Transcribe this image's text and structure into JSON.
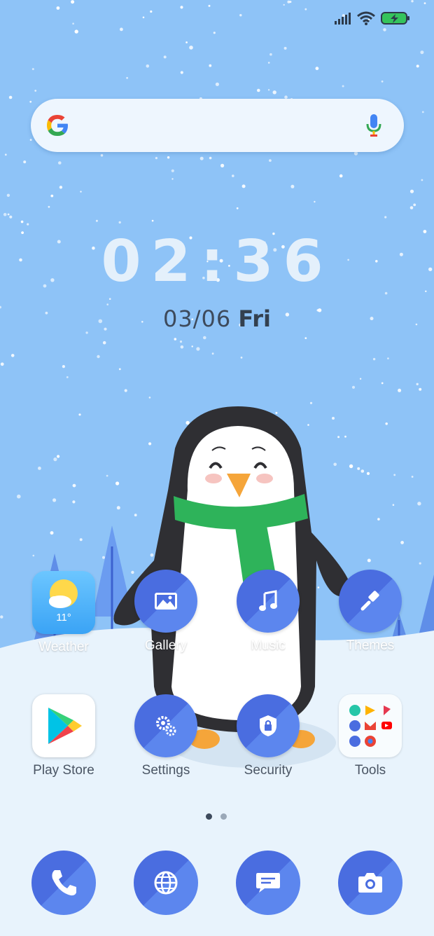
{
  "status_bar": {
    "icons": [
      "signal-icon",
      "wifi-icon",
      "battery-charging-icon"
    ]
  },
  "search": {
    "logo": "google-g-icon",
    "voice": "microphone-icon"
  },
  "clock": {
    "time": "02:36",
    "date": "03/06",
    "day": "Fri"
  },
  "weather_widget": {
    "temperature": "11°"
  },
  "apps_row1": [
    {
      "label": "Weather",
      "icon": "weather-icon"
    },
    {
      "label": "Gallery",
      "icon": "gallery-icon"
    },
    {
      "label": "Music",
      "icon": "music-note-icon"
    },
    {
      "label": "Themes",
      "icon": "paintbrush-icon"
    }
  ],
  "apps_row2": [
    {
      "label": "Play Store",
      "icon": "play-store-icon"
    },
    {
      "label": "Settings",
      "icon": "gears-icon"
    },
    {
      "label": "Security",
      "icon": "shield-lock-icon"
    },
    {
      "label": "Tools",
      "icon": "folder-icon"
    }
  ],
  "page_indicator": {
    "pages": 2,
    "current": 1
  },
  "dock": [
    {
      "icon": "phone-icon"
    },
    {
      "icon": "browser-globe-icon"
    },
    {
      "icon": "messages-icon"
    },
    {
      "icon": "camera-icon"
    }
  ],
  "colors": {
    "sky": "#8ec3f7",
    "snow_ground": "#e8f3fc",
    "icon_blue_dark": "#4a6de0",
    "icon_blue_light": "#5c86ee",
    "scarf_green": "#2eb35a",
    "beak_orange": "#f5a53a"
  }
}
